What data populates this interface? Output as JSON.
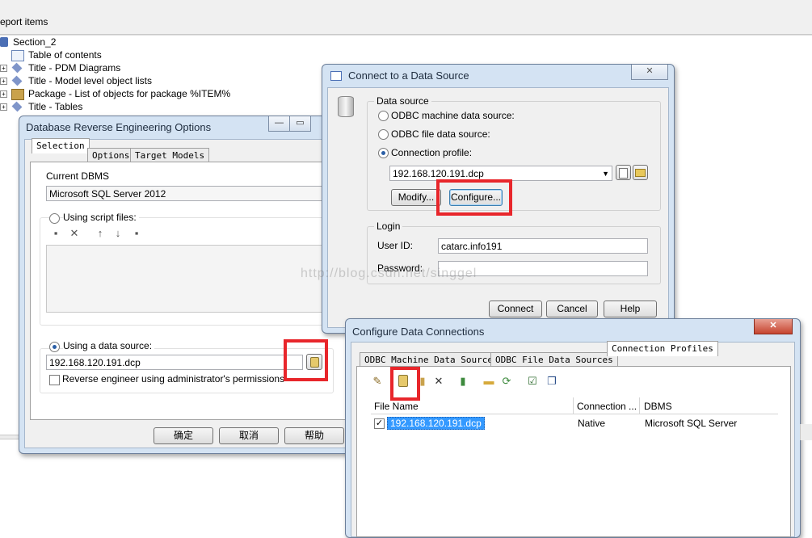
{
  "background": {
    "header_label": "eport items",
    "tree": [
      {
        "label": "Section_2",
        "icon": "section-icon"
      },
      {
        "label": "Table of contents",
        "icon": "toc-icon"
      },
      {
        "label": "Title - PDM Diagrams",
        "icon": "diamond-icon"
      },
      {
        "label": "Title - Model level object lists",
        "icon": "diamond-icon"
      },
      {
        "label": "Package - List of objects for package %ITEM%",
        "icon": "package-icon"
      },
      {
        "label": "Title - Tables",
        "icon": "diamond-icon"
      }
    ]
  },
  "reverse_dialog": {
    "title": "Database Reverse Engineering Options",
    "tabs": [
      "Selection",
      "Options",
      "Target Models"
    ],
    "current_dbms_label": "Current DBMS",
    "current_dbms_value": "Microsoft SQL Server 2012",
    "script_files_label": "Using script files:",
    "data_source_label": "Using a data source:",
    "data_source_value": "192.168.120.191.dcp",
    "admin_check_label": "Reverse engineer using administrator's permissions",
    "ok_label": "确定",
    "cancel_label": "取消",
    "help_label": "帮助"
  },
  "connect_dialog": {
    "title": "Connect to a Data Source",
    "group_title": "Data source",
    "opt_machine": "ODBC machine data source:",
    "opt_file": "ODBC file data source:",
    "opt_profile": "Connection profile:",
    "profile_value": "192.168.120.191.dcp",
    "modify_label": "Modify...",
    "configure_label": "Configure...",
    "login_title": "Login",
    "user_id_label": "User ID:",
    "user_id_value": "catarc.info191",
    "password_label": "Password:",
    "connect_label": "Connect",
    "cancel_label": "Cancel",
    "help_label": "Help"
  },
  "configure_dialog": {
    "title": "Configure Data Connections",
    "tabs": [
      "ODBC Machine Data Sources",
      "ODBC File Data Sources",
      "Connection Profiles"
    ],
    "columns": [
      "File Name",
      "Connection ...",
      "DBMS"
    ],
    "rows": [
      {
        "file": "192.168.120.191.dcp",
        "connection": "Native",
        "dbms": "Microsoft SQL Server",
        "checked": true
      }
    ]
  },
  "watermark": "http://blog.csdn.net/singgel",
  "colors": {
    "highlight": "#e8262b",
    "selection": "#3399ff"
  }
}
